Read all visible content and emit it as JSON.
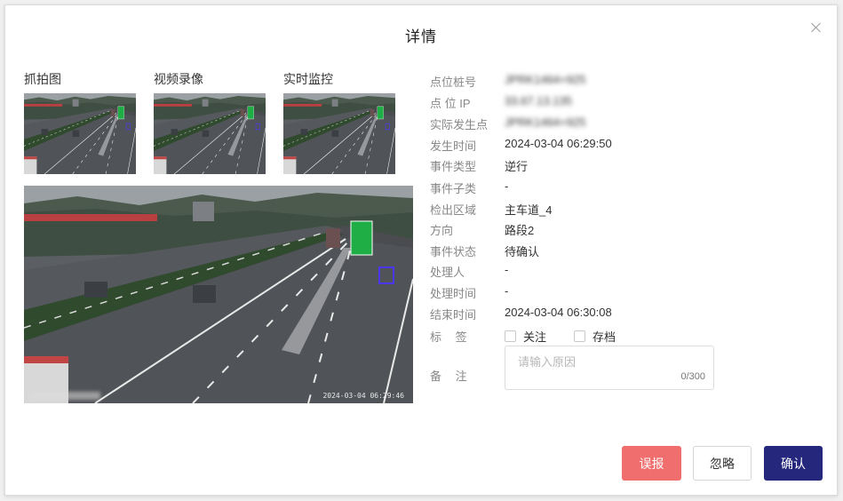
{
  "dialog": {
    "title": "详情"
  },
  "media": {
    "tabs": [
      "抓拍图",
      "视频录像",
      "实时监控"
    ],
    "timestamp": "2024-03-04 06:29:46"
  },
  "details": {
    "stake_label": "点位桩号",
    "stake_value": "JPRK1464+925",
    "ip_label": "点 位 IP",
    "ip_value": "33.67.13.135",
    "actual_label": "实际发生点",
    "actual_value": "JPRK1464+925",
    "time_label": "发生时间",
    "time_value": "2024-03-04 06:29:50",
    "type_label": "事件类型",
    "type_value": "逆行",
    "subtype_label": "事件子类",
    "subtype_value": "-",
    "zone_label": "检出区域",
    "zone_value": "主车道_4",
    "direction_label": "方向",
    "direction_value": "路段2",
    "status_label": "事件状态",
    "status_value": "待确认",
    "handler_label": "处理人",
    "handler_value": "-",
    "handle_time_label": "处理时间",
    "handle_time_value": "-",
    "end_label": "结束时间",
    "end_value": "2024-03-04 06:30:08",
    "tag_label": "标 签",
    "tag_options": [
      "关注",
      "存档"
    ],
    "remark_label": "备 注",
    "remark_placeholder": "请输入原因",
    "remark_counter": "0/300"
  },
  "buttons": {
    "false_alarm": "误报",
    "ignore": "忽略",
    "confirm": "确认"
  },
  "colors": {
    "false_alarm": "#f06e6e",
    "confirm": "#25277c",
    "sign_green": "#1fae45"
  }
}
